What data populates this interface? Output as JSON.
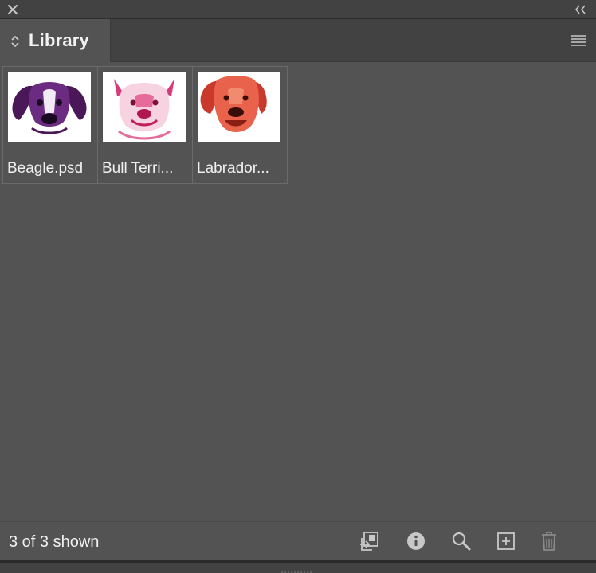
{
  "panel": {
    "title": "Library"
  },
  "items": [
    {
      "label": "Beagle.psd"
    },
    {
      "label": "Bull Terri..."
    },
    {
      "label": "Labrador..."
    }
  ],
  "footer": {
    "count": "3 of 3 shown",
    "icons": [
      "place-item-icon",
      "info-icon",
      "search-icon",
      "new-item-icon",
      "trash-icon"
    ]
  },
  "colors": {
    "panel_bg": "#535353",
    "header_bg": "#424242",
    "beagle": "#5a1e6e",
    "bullterrier": "#e0407f",
    "labrador": "#e0604a"
  }
}
